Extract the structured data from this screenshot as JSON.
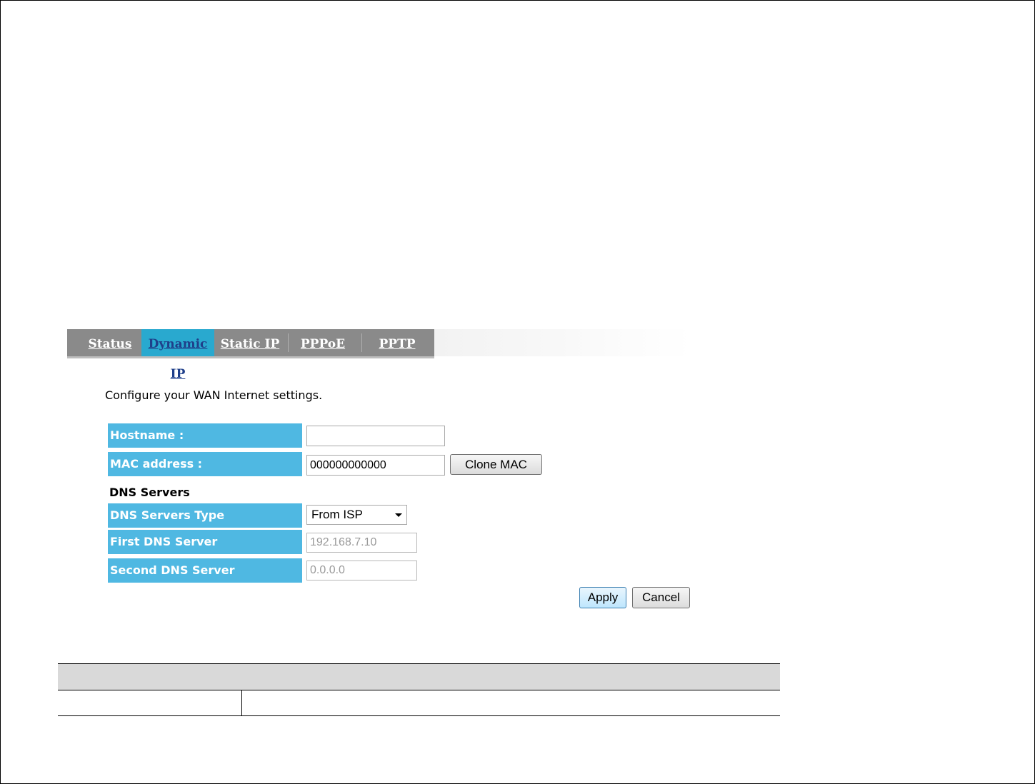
{
  "tabs": {
    "status": "Status",
    "dynamic_ip": "Dynamic IP",
    "static_ip": "Static IP",
    "pppoe": "PPPoE",
    "pptp": "PPTP",
    "active": "Dynamic IP"
  },
  "intro_text": "Configure your WAN Internet settings.",
  "form": {
    "hostname": {
      "label": "Hostname :",
      "value": ""
    },
    "mac": {
      "label": "MAC address :",
      "value": "000000000000",
      "clone_button": "Clone MAC"
    },
    "dns_section_title": "DNS Servers",
    "dns_type": {
      "label": "DNS Servers Type",
      "selected": "From ISP"
    },
    "first_dns": {
      "label": "First DNS Server",
      "value": "192.168.7.10"
    },
    "second_dns": {
      "label": "Second DNS Server",
      "value": "0.0.0.0"
    }
  },
  "actions": {
    "apply": "Apply",
    "cancel": "Cancel"
  },
  "colors": {
    "label_bg": "#4fb8e2",
    "tab_bar": "#8a8a8a",
    "tab_active": "#29a9cf"
  }
}
